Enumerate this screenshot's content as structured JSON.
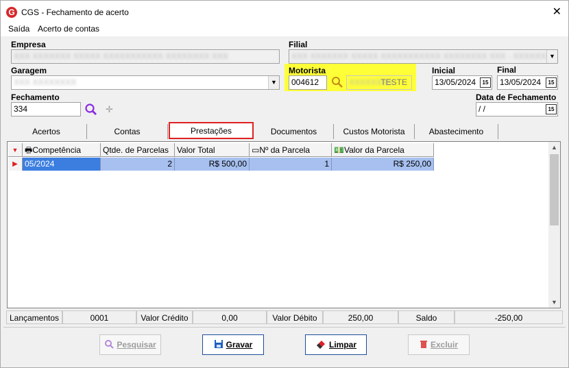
{
  "window": {
    "title": "CGS - Fechamento de acerto",
    "close_glyph": "✕",
    "app_icon_letter": "G"
  },
  "menu": {
    "items": [
      "Saída",
      "Acerto de contas"
    ]
  },
  "form": {
    "empresa_label": "Empresa",
    "empresa_value": "XXX XXXXXXX XXXXX XXXXXXXXXXX XXXXXXXX XXX",
    "filial_label": "Filial",
    "filial_value": "XXX XXXXXXX XXXXX XXXXXXXXXXX XXXXXXXX XXX - XXXXXXX",
    "garagem_label": "Garagem",
    "garagem_value": "XXX XXXXXXXX",
    "motorista_label": "Motorista",
    "motorista_code": "004612",
    "motorista_name_hidden": "XXXXXXXX",
    "motorista_name_visible": "TESTE",
    "inicial_label": "Inicial",
    "inicial_value": "13/05/2024",
    "final_label": "Final",
    "final_value": "13/05/2024",
    "fechamento_label": "Fechamento",
    "fechamento_value": "334",
    "data_fechamento_label": "Data de Fechamento",
    "data_fechamento_value": " /  /",
    "calendar_glyph": "15",
    "plus_glyph": "✛"
  },
  "tabs": [
    "Acertos",
    "Contas",
    "Prestações",
    "Documentos",
    "Custos Motorista",
    "Abastecimento"
  ],
  "grid": {
    "columns": [
      "Competência",
      "Qtde. de Parcelas",
      "Valor Total",
      "Nº da Parcela",
      "Valor da Parcela"
    ],
    "rows": [
      {
        "competencia": "05/2024",
        "qtde_parcelas": "2",
        "valor_total": "R$ 500,00",
        "n_parcela": "1",
        "valor_parcela": "R$ 250,00"
      }
    ]
  },
  "status": {
    "lancamentos_label": "Lançamentos",
    "lancamentos_value": "0001",
    "valor_credito_label": "Valor Crédito",
    "valor_credito_value": "0,00",
    "valor_debito_label": "Valor Débito",
    "valor_debito_value": "250,00",
    "saldo_label": "Saldo",
    "saldo_value": "-250,00"
  },
  "buttons": {
    "pesquisar": "Pesquisar",
    "gravar": "Gravar",
    "limpar": "Limpar",
    "excluir": "Excluir"
  },
  "colors": {
    "highlight": "#ffff38",
    "active_tab_border": "#e02020",
    "selected_row": "#a7c0ef",
    "search_icon": "#8a2be2"
  }
}
